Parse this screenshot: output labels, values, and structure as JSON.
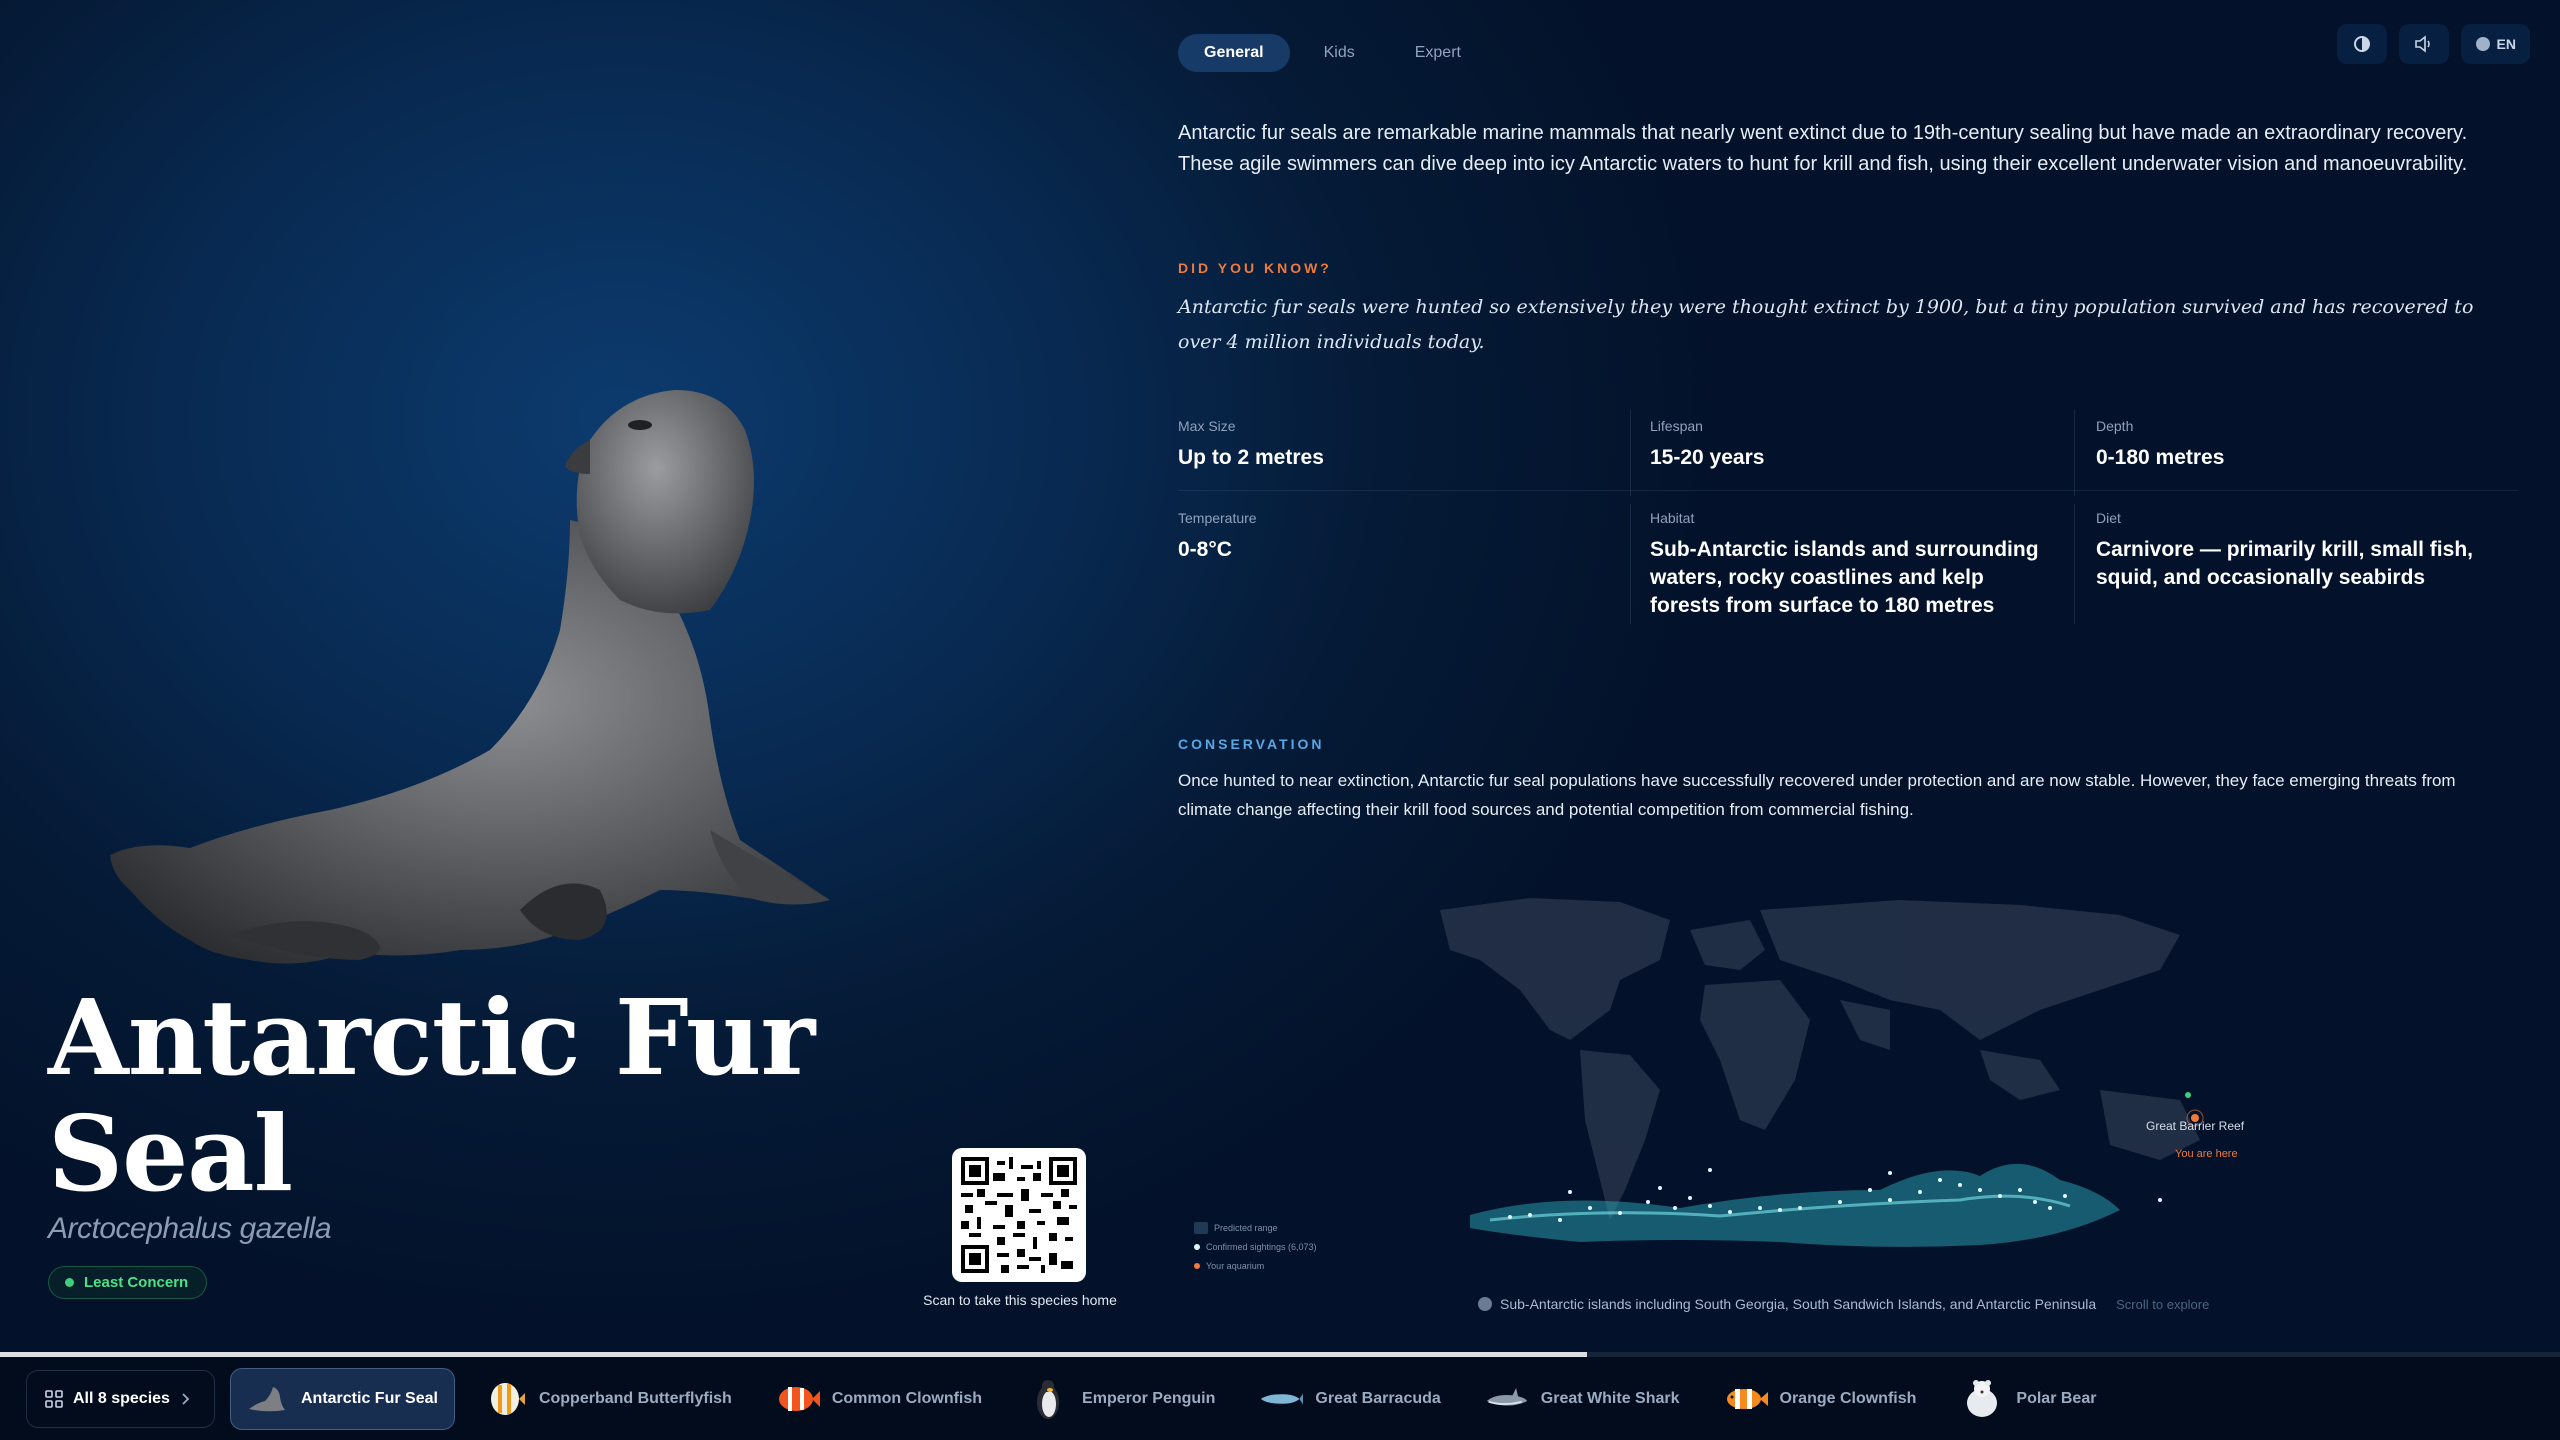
{
  "tabs": [
    {
      "label": "General",
      "active": true
    },
    {
      "label": "Kids",
      "active": false
    },
    {
      "label": "Expert",
      "active": false
    }
  ],
  "controls": {
    "contrast_icon": "contrast-icon",
    "audio_icon": "speaker-icon",
    "language": "EN"
  },
  "intro": "Antarctic fur seals are remarkable marine mammals that nearly went extinct due to 19th-century sealing but have made an extraordinary recovery. These agile swimmers can dive deep into icy Antarctic waters to hunt for krill and fish, using their excellent underwater vision and manoeuvrability.",
  "did_you_know": {
    "label": "DID YOU KNOW?",
    "text": "Antarctic fur seals were hunted so extensively they were thought extinct by 1900, but a tiny population survived and has recovered to over 4 million individuals today."
  },
  "facts": [
    {
      "label": "Max Size",
      "value": "Up to 2 metres"
    },
    {
      "label": "Lifespan",
      "value": "15-20 years"
    },
    {
      "label": "Depth",
      "value": "0-180 metres"
    },
    {
      "label": "Temperature",
      "value": "0-8°C"
    },
    {
      "label": "Habitat",
      "value": "Sub-Antarctic islands and surrounding waters, rocky coastlines and kelp forests from surface to 180 metres"
    },
    {
      "label": "Diet",
      "value": "Carnivore — primarily krill, small fish, squid, and occasionally seabirds"
    }
  ],
  "conservation": {
    "label": "CONSERVATION",
    "text": "Once hunted to near extinction, Antarctic fur seal populations have successfully recovered under protection and are now stable. However, they face emerging threats from climate change affecting their krill food sources and potential competition from commercial fishing."
  },
  "map": {
    "legend": [
      "Predicted range",
      "Confirmed sightings (6,073)",
      "Your aquarium"
    ],
    "reef_label": "Great Barrier Reef",
    "here_label": "You are here",
    "caption": "Sub-Antarctic islands including South Georgia, South Sandwich Islands, and Antarctic Peninsula",
    "hint": "Scroll to explore",
    "colors": {
      "range": "#2fb6c4",
      "sightings": "#dff8ff",
      "aquarium": "#f07a3a"
    }
  },
  "species": {
    "common_name": "Antarctic Fur Seal",
    "latin_name": "Arctocephalus gazella",
    "status": "Least Concern",
    "status_color": "#3ecf7e"
  },
  "qr": {
    "caption": "Scan to take this species home"
  },
  "progress": 0.62,
  "bottom": {
    "all_label": "All 8 species",
    "items": [
      {
        "label": "Antarctic Fur Seal",
        "icon": "seal-icon",
        "active": true
      },
      {
        "label": "Copperband Butterflyfish",
        "icon": "butterflyfish-icon",
        "active": false
      },
      {
        "label": "Common Clownfish",
        "icon": "clownfish-icon",
        "active": false
      },
      {
        "label": "Emperor Penguin",
        "icon": "penguin-icon",
        "active": false
      },
      {
        "label": "Great Barracuda",
        "icon": "barracuda-icon",
        "active": false
      },
      {
        "label": "Great White Shark",
        "icon": "shark-icon",
        "active": false
      },
      {
        "label": "Orange Clownfish",
        "icon": "orange-clownfish-icon",
        "active": false
      },
      {
        "label": "Polar Bear",
        "icon": "polar-bear-icon",
        "active": false
      }
    ]
  }
}
